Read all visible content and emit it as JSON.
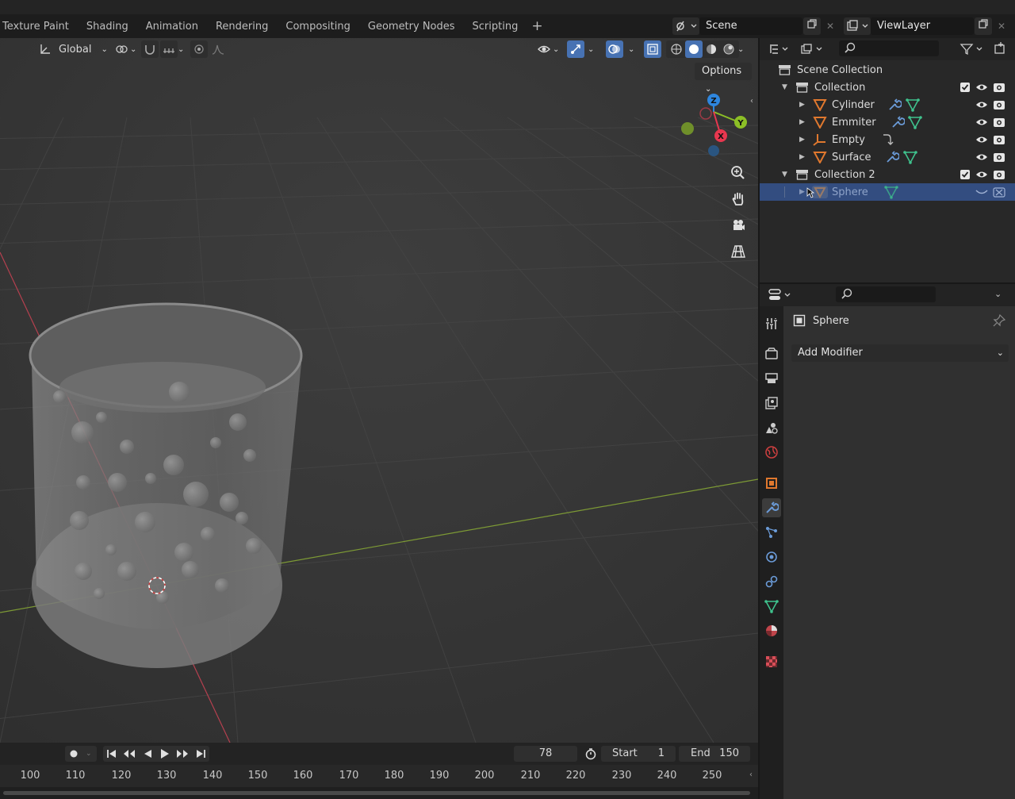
{
  "workspace_tabs": [
    "Texture Paint",
    "Shading",
    "Animation",
    "Rendering",
    "Compositing",
    "Geometry Nodes",
    "Scripting"
  ],
  "add_workspace": "+",
  "scene": {
    "name": "Scene"
  },
  "view_layer": {
    "name": "ViewLayer"
  },
  "viewport": {
    "transform_orientation": "Global",
    "options_label": "Options",
    "gizmo": {
      "z": "Z",
      "y": "Y",
      "x": "X"
    }
  },
  "outliner": {
    "root": "Scene Collection",
    "rows": [
      {
        "label": "Collection",
        "type": "collection"
      },
      {
        "label": "Cylinder",
        "type": "mesh",
        "mods": [
          "wrench",
          "mesh"
        ]
      },
      {
        "label": "Emmiter",
        "type": "mesh",
        "mods": [
          "wrench",
          "mesh"
        ]
      },
      {
        "label": "Empty",
        "type": "empty",
        "mods": [
          "constraint"
        ]
      },
      {
        "label": "Surface",
        "type": "mesh",
        "mods": [
          "wrench",
          "mesh"
        ]
      },
      {
        "label": "Collection 2",
        "type": "collection"
      },
      {
        "label": "Sphere",
        "type": "mesh",
        "mods": [
          "mesh"
        ],
        "selected": true
      }
    ]
  },
  "properties": {
    "object_name": "Sphere",
    "add_modifier_label": "Add Modifier"
  },
  "timeline": {
    "current_frame": "78",
    "start_label": "Start",
    "start_value": "1",
    "end_label": "End",
    "end_value": "150",
    "frame_ticks": [
      "100",
      "110",
      "120",
      "130",
      "140",
      "150",
      "160",
      "170",
      "180",
      "190",
      "200",
      "210",
      "220",
      "230",
      "240",
      "250"
    ]
  },
  "colors": {
    "accent": "#4772b3",
    "selected_row": "#334d80",
    "object_orange": "#e0782e",
    "axis_x": "#e8374f",
    "axis_y": "#8cbf26",
    "axis_z": "#2e86de",
    "modifier_blue": "#6b9bd8",
    "mesh_green": "#3fc28d"
  }
}
